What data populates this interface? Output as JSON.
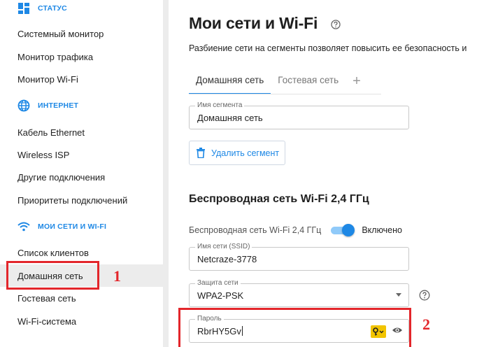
{
  "sidebar": {
    "sections": [
      {
        "label": "СТАТУС",
        "icon": "dashboard-icon"
      },
      {
        "label": "ИНТЕРНЕТ",
        "icon": "globe-icon"
      },
      {
        "label": "МОИ СЕТИ И WI-FI",
        "icon": "wifi-icon"
      }
    ],
    "items": [
      {
        "label": "Системный монитор"
      },
      {
        "label": "Монитор трафика"
      },
      {
        "label": "Монитор Wi-Fi"
      },
      {
        "label": "Кабель Ethernet"
      },
      {
        "label": "Wireless ISP"
      },
      {
        "label": "Другие подключения"
      },
      {
        "label": "Приоритеты подключений"
      },
      {
        "label": "Список клиентов"
      },
      {
        "label": "Домашняя сеть"
      },
      {
        "label": "Гостевая сеть"
      },
      {
        "label": "Wi-Fi-система"
      }
    ],
    "active_item": "Домашняя сеть"
  },
  "annotations": {
    "marker_1": "1",
    "marker_2": "2",
    "color": "#e3262b"
  },
  "main": {
    "title": "Мои сети и Wi-Fi",
    "description": "Разбиение сети на сегменты позволяет повысить ее безопасность и",
    "tabs": [
      {
        "label": "Домашняя сеть",
        "active": true
      },
      {
        "label": "Гостевая сеть",
        "active": false
      }
    ],
    "add_tab": "+",
    "segment_name": {
      "label": "Имя сегмента",
      "value": "Домашняя сеть"
    },
    "delete_button": "Удалить сегмент",
    "wifi_section_title": "Беспроводная сеть Wi-Fi 2,4 ГГц",
    "wifi_toggle": {
      "label": "Беспроводная сеть Wi-Fi 2,4 ГГц",
      "state": "Включено",
      "on": true
    },
    "ssid": {
      "label": "Имя сети (SSID)",
      "value": "Netcraze-3778"
    },
    "security": {
      "label": "Защита сети",
      "value": "WPA2-PSK"
    },
    "password": {
      "label": "Пароль",
      "value": "RbrHY5Gv"
    }
  },
  "colors": {
    "accent": "#1e88e5",
    "highlight": "#e3262b",
    "key_badge": "#f2c400"
  }
}
